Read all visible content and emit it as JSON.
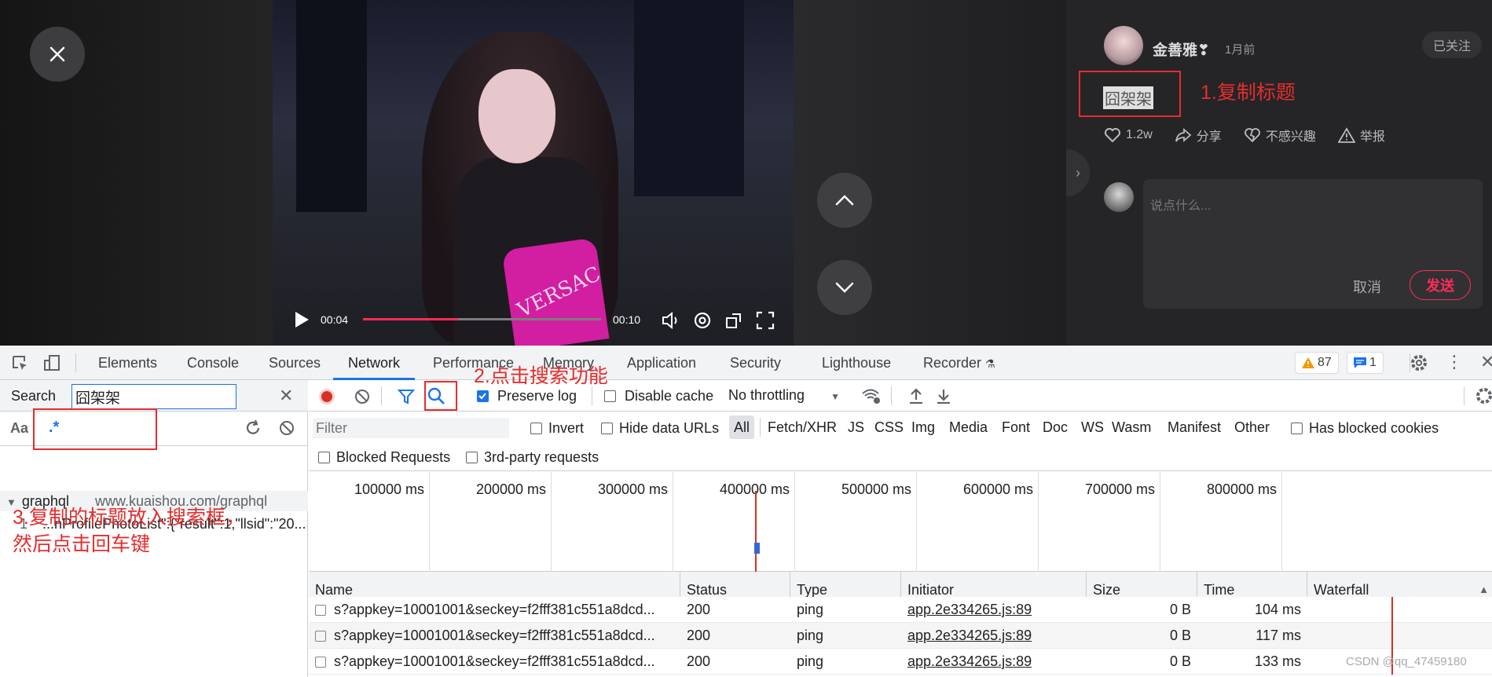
{
  "video": {
    "current_time": "00:04",
    "duration": "00:10",
    "progress_fraction": 0.4,
    "overlay_text": "VERSAC"
  },
  "post": {
    "author": "金善雅❣",
    "time_ago": "1月前",
    "follow_label": "已关注",
    "title": "囧架架",
    "likes": "1.2w",
    "share_label": "分享",
    "dislike_label": "不感兴趣",
    "report_label": "举报",
    "comment_placeholder": "说点什么...",
    "cancel_label": "取消",
    "send_label": "发送"
  },
  "annotations": {
    "step1": "1.复制标题",
    "step2": "2.点击搜索功能",
    "step3_line1": "3.复制的标题放入搜索框，",
    "step3_line2": "然后点击回车键"
  },
  "devtools": {
    "tabs": [
      "Elements",
      "Console",
      "Sources",
      "Network",
      "Performance",
      "Memory",
      "Application",
      "Security",
      "Lighthouse",
      "Recorder"
    ],
    "active_tab": "Network",
    "warnings_count": "87",
    "messages_count": "1",
    "search": {
      "title": "Search",
      "case_label": "Aa",
      "regex_label": ".*",
      "query": "囧架架",
      "result_file": "graphql",
      "result_url": "www.kuaishou.com/graphql",
      "result_line_no": "1",
      "result_line": "...nProfilePhotoList\":{\"result\":1,\"llsid\":\"20..."
    },
    "toolbar": {
      "preserve_log": "Preserve log",
      "disable_cache": "Disable cache",
      "throttling": "No throttling"
    },
    "filter": {
      "placeholder": "Filter",
      "invert": "Invert",
      "hide_data_urls": "Hide data URLs",
      "types": [
        "All",
        "Fetch/XHR",
        "JS",
        "CSS",
        "Img",
        "Media",
        "Font",
        "Doc",
        "WS",
        "Wasm",
        "Manifest",
        "Other"
      ],
      "has_blocked_cookies": "Has blocked cookies",
      "blocked_requests": "Blocked Requests",
      "third_party": "3rd-party requests"
    },
    "overview_ticks": [
      "100000 ms",
      "200000 ms",
      "300000 ms",
      "400000 ms",
      "500000 ms",
      "600000 ms",
      "700000 ms",
      "800000 ms"
    ],
    "columns": [
      "Name",
      "Status",
      "Type",
      "Initiator",
      "Size",
      "Time",
      "Waterfall"
    ],
    "rows": [
      {
        "name": "s?appkey=10001001&seckey=f2fff381c551a8dcd...",
        "status": "200",
        "type": "ping",
        "initiator": "app.2e334265.js:89",
        "size": "0 B",
        "time": "104 ms"
      },
      {
        "name": "s?appkey=10001001&seckey=f2fff381c551a8dcd...",
        "status": "200",
        "type": "ping",
        "initiator": "app.2e334265.js:89",
        "size": "0 B",
        "time": "117 ms"
      },
      {
        "name": "s?appkey=10001001&seckey=f2fff381c551a8dcd...",
        "status": "200",
        "type": "ping",
        "initiator": "app.2e334265.js:89",
        "size": "0 B",
        "time": "133 ms"
      }
    ]
  },
  "watermark": "CSDN @qq_47459180",
  "colors": {
    "accent": "#fe2c55",
    "annotation": "#e42d2d",
    "devtools_blue": "#1a73e8"
  }
}
